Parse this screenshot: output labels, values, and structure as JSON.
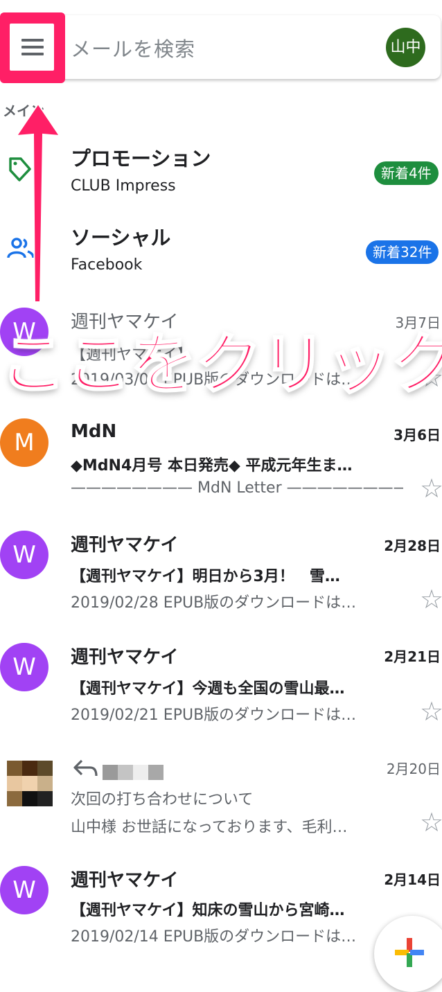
{
  "search": {
    "placeholder": "メールを検索"
  },
  "account": {
    "initials": "山中"
  },
  "section": {
    "label": "メイン"
  },
  "categories": [
    {
      "title": "プロモーション",
      "sender": "CLUB Impress",
      "badge": "新着4件",
      "badge_color": "#1e8e3e"
    },
    {
      "title": "ソーシャル",
      "sender": "Facebook",
      "badge": "新着32件",
      "badge_color": "#1a73e8"
    }
  ],
  "emails": [
    {
      "avatar": "W",
      "avatar_color": "#a142f4",
      "sender": "週刊ヤマケイ",
      "date": "3月7日",
      "subject": "【週刊ヤマケイ】",
      "snippet": "2019/03/07 EPUB版のダウンロードは…",
      "unread": false
    },
    {
      "avatar": "M",
      "avatar_color": "#f07d1e",
      "sender": "MdN",
      "date": "3月6日",
      "subject": "◆MdN4月号 本日発売◆ 平成元年生ま…",
      "snippet": "———————— MdN Letter ————————————————…",
      "unread": true
    },
    {
      "avatar": "W",
      "avatar_color": "#a142f4",
      "sender": "週刊ヤマケイ",
      "date": "2月28日",
      "subject": "【週刊ヤマケイ】明日から3月！　雪…",
      "snippet": "2019/02/28 EPUB版のダウンロードは…",
      "unread": true
    },
    {
      "avatar": "W",
      "avatar_color": "#a142f4",
      "sender": "週刊ヤマケイ",
      "date": "2月21日",
      "subject": "【週刊ヤマケイ】今週も全国の雪山最…",
      "snippet": "2019/02/21 EPUB版のダウンロードは…",
      "unread": true
    },
    {
      "avatar": "",
      "avatar_color": "#8b6a3e",
      "sender": "",
      "date": "2月20日",
      "subject": "次回の打ち合わせについて",
      "snippet": "山中様 お世話になっております、毛利…",
      "unread": false
    },
    {
      "avatar": "W",
      "avatar_color": "#a142f4",
      "sender": "週刊ヤマケイ",
      "date": "2月14日",
      "subject": "【週刊ヤマケイ】知床の雪山から宮崎…",
      "snippet": "2019/02/14 EPUB版のダウンロードは…",
      "unread": true
    }
  ],
  "annotation": {
    "text": "ここをクリック",
    "color": "#ff1f66"
  }
}
